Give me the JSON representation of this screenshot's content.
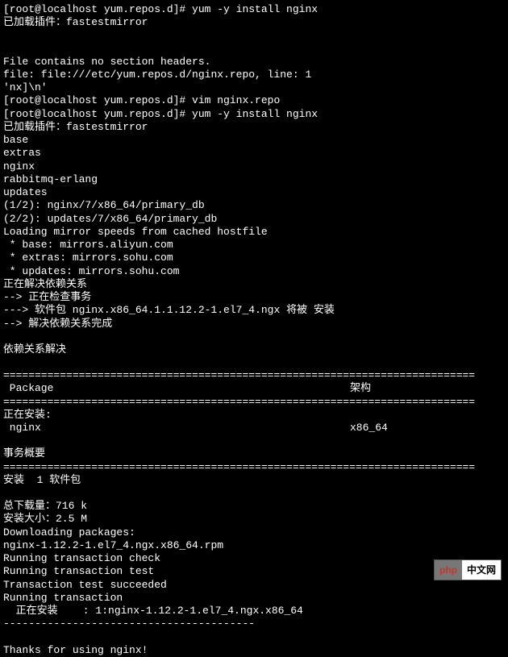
{
  "lines": {
    "l1": "[root@localhost yum.repos.d]# yum -y install nginx",
    "l2": "已加载插件：fastestmirror",
    "l3": "File contains no section headers.",
    "l4": "file: file:///etc/yum.repos.d/nginx.repo, line: 1",
    "l5": "'nx]\\n'",
    "l6": "[root@localhost yum.repos.d]# vim nginx.repo",
    "l7": "[root@localhost yum.repos.d]# yum -y install nginx",
    "l8": "已加载插件：fastestmirror",
    "l9": "base",
    "l10": "extras",
    "l11": "nginx",
    "l12": "rabbitmq-erlang",
    "l13": "updates",
    "l14": "(1/2): nginx/7/x86_64/primary_db",
    "l15": "(2/2): updates/7/x86_64/primary_db",
    "l16": "Loading mirror speeds from cached hostfile",
    "l17": " * base: mirrors.aliyun.com",
    "l18": " * extras: mirrors.sohu.com",
    "l19": " * updates: mirrors.sohu.com",
    "l20": "正在解决依赖关系",
    "l21": "--> 正在检查事务",
    "l22": "---> 软件包 nginx.x86_64.1.1.12.2-1.el7_4.ngx 将被 安装",
    "l23": "--> 解决依赖关系完成",
    "l24": "依赖关系解决",
    "l25": " Package",
    "l26": "架构",
    "l27": "正在安装:",
    "l28": " nginx",
    "l29": "x86_64",
    "l30": "事务概要",
    "l31": "安装  1 软件包",
    "l32": "总下载量：716 k",
    "l33": "安装大小：2.5 M",
    "l34": "Downloading packages:",
    "l35": "nginx-1.12.2-1.el7_4.ngx.x86_64.rpm",
    "l36": "Running transaction check",
    "l37": "Running transaction test",
    "l38": "Transaction test succeeded",
    "l39": "Running transaction",
    "l40": "  正在安装    : 1:nginx-1.12.2-1.el7_4.ngx.x86_64",
    "l41": "----------------------------------------",
    "l42": "Thanks for using nginx!"
  },
  "rules": {
    "eq": "==========================================================================="
  },
  "badge": {
    "php": "php",
    "cn": "中文网"
  }
}
